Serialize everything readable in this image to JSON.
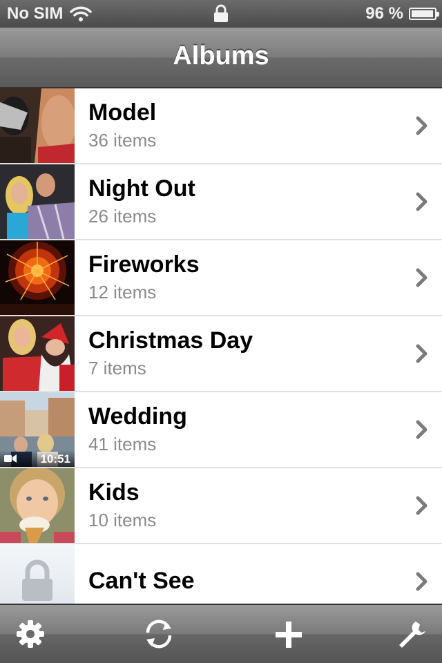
{
  "status_bar": {
    "carrier": "No SIM",
    "battery_percent": "96 %",
    "battery_level": 0.96,
    "icons": [
      "wifi-icon",
      "lock-icon",
      "battery-icon"
    ]
  },
  "nav": {
    "title": "Albums"
  },
  "albums": [
    {
      "title": "Model",
      "subtitle": "36 items"
    },
    {
      "title": "Night Out",
      "subtitle": "26 items"
    },
    {
      "title": "Fireworks",
      "subtitle": "12 items"
    },
    {
      "title": "Christmas Day",
      "subtitle": "7 items"
    },
    {
      "title": "Wedding",
      "subtitle": "41 items",
      "video_duration": "10:51"
    },
    {
      "title": "Kids",
      "subtitle": "10 items"
    },
    {
      "title": "Can't See",
      "subtitle": "",
      "locked": true
    }
  ],
  "toolbar": {
    "icons": [
      "gear-icon",
      "refresh-icon",
      "plus-icon",
      "wrench-icon"
    ]
  },
  "colors": {
    "bar_gray": "#6b6b6b",
    "subtitle_gray": "#8a8a8a",
    "chevron_gray": "#7a7a7a"
  }
}
